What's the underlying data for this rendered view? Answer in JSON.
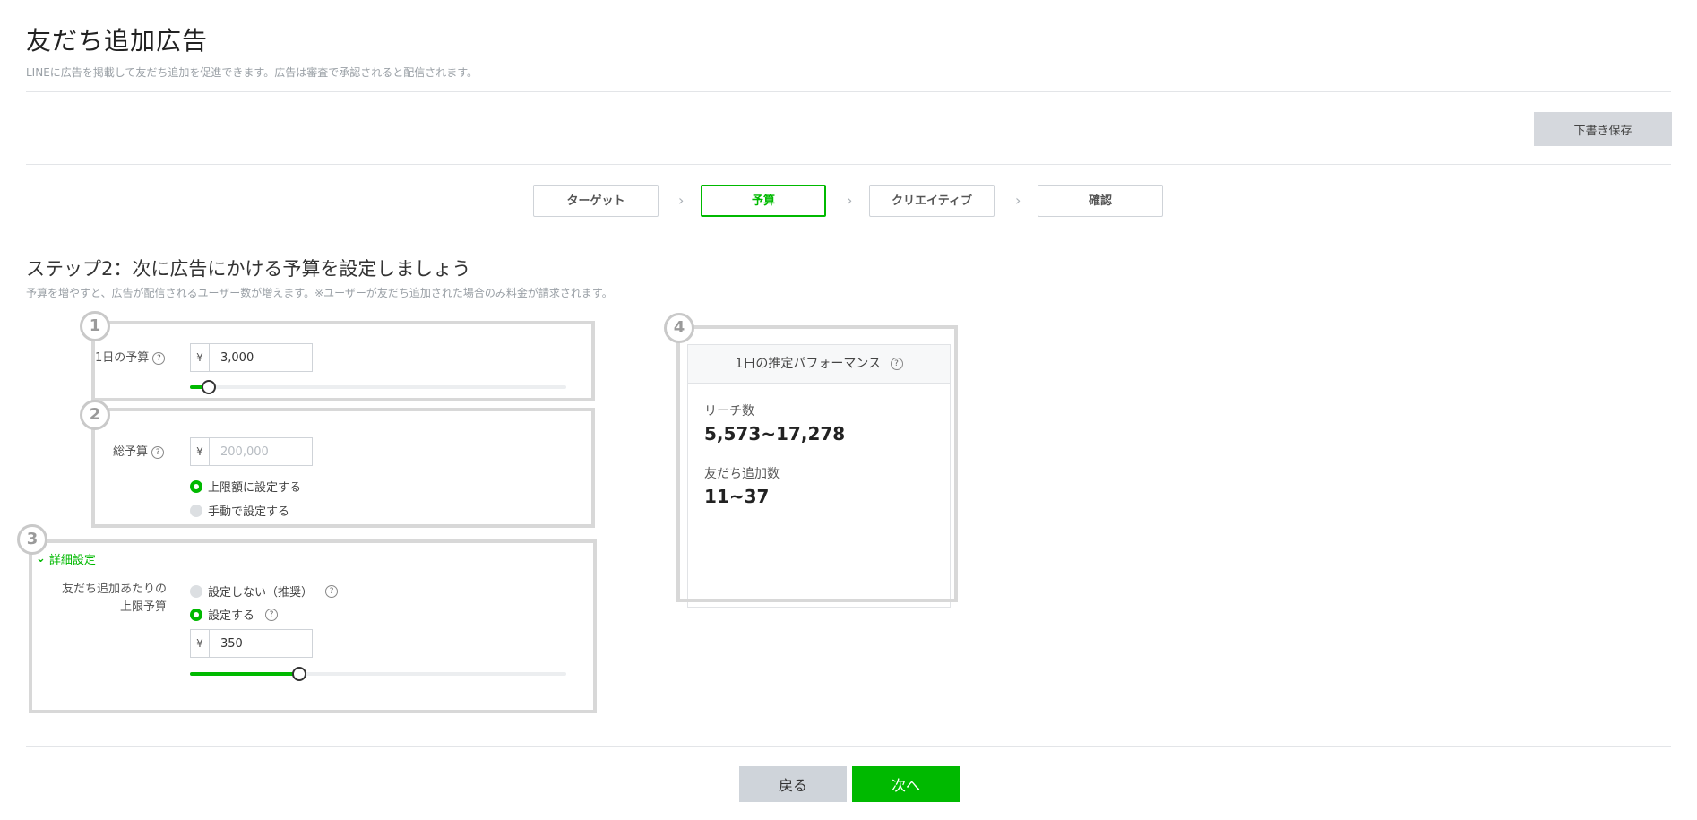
{
  "page": {
    "title": "友だち追加広告",
    "subtitle": "LINEに広告を掲載して友だち追加を促進できます。広告は審査で承認されると配信されます。",
    "draft_save_label": "下書き保存"
  },
  "steps": [
    {
      "label": "ターゲット"
    },
    {
      "label": "予算"
    },
    {
      "label": "クリエイティブ"
    },
    {
      "label": "確認"
    }
  ],
  "step_chevron": "›",
  "section": {
    "heading": "ステップ2：次に広告にかける予算を設定しましょう",
    "description": "予算を増やすと、広告が配信されるユーザー数が増えます。※ユーザーが友だち追加された場合のみ料金が請求されます。"
  },
  "badges": [
    "1",
    "2",
    "3",
    "4"
  ],
  "currency_symbol": "¥",
  "help_mark": "?",
  "daily_budget": {
    "label": "1日の予算",
    "value": "3,000",
    "slider_fraction": 0.05
  },
  "total_budget": {
    "label": "総予算",
    "placeholder": "200,000",
    "option_limit": "上限額に設定する",
    "option_manual": "手動で設定する",
    "selected": "limit"
  },
  "advanced": {
    "toggle_label": "詳細設定",
    "toggle_icon": "⌄",
    "field_label_line1": "友だち追加あたりの",
    "field_label_line2": "上限予算",
    "option_none": "設定しない（推奨）",
    "option_set": "設定する",
    "selected": "set",
    "value": "350",
    "slider_fraction": 0.29
  },
  "performance": {
    "title": "1日の推定パフォーマンス",
    "reach_label": "リーチ数",
    "reach_value": "5,573~17,278",
    "friends_label": "友だち追加数",
    "friends_value": "11~37"
  },
  "footer": {
    "back_label": "戻る",
    "next_label": "次へ"
  },
  "colors": {
    "accent": "#00b900",
    "annotation_border": "#d8d8d8"
  }
}
